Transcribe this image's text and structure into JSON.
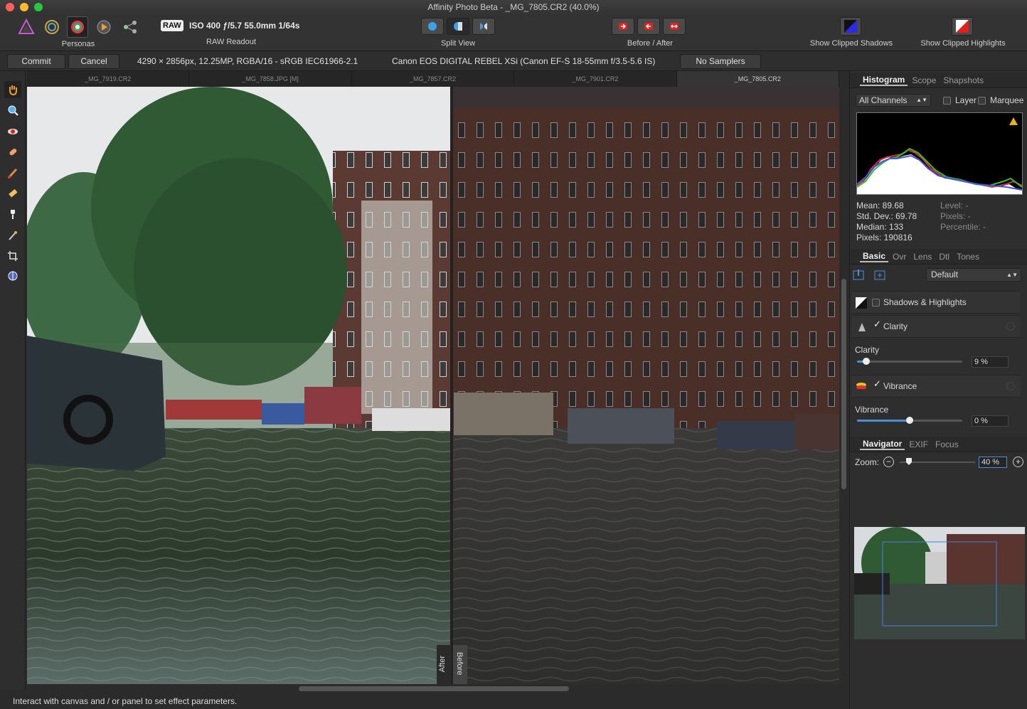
{
  "window": {
    "title": "Affinity Photo Beta - _MG_7805.CR2 (40.0%)"
  },
  "toolbar": {
    "personas_label": "Personas",
    "raw_badge": "RAW",
    "raw_readout_text": "ISO 400 ƒ/5.7 55.0mm 1/64s",
    "raw_readout_label": "RAW Readout",
    "split_view_label": "Split View",
    "before_after_label": "Before / After",
    "show_clipped_shadows": "Show Clipped Shadows",
    "show_clipped_highlights": "Show Clipped Highlights"
  },
  "context": {
    "commit": "Commit",
    "cancel": "Cancel",
    "image_info": "4290 × 2856px, 12.25MP, RGBA/16 - sRGB IEC61966-2.1",
    "camera_info": "Canon EOS DIGITAL REBEL XSi (Canon EF-S 18-55mm f/3.5-5.6 IS)",
    "samplers": "No Samplers"
  },
  "doc_tabs": [
    "_MG_7919.CR2",
    "_MG_7858.JPG [M]",
    "_MG_7857.CR2",
    "_MG_7901.CR2",
    "_MG_7805.CR2"
  ],
  "canvas": {
    "after_label": "After",
    "before_label": "Before"
  },
  "status": "Interact with canvas and / or panel to set effect parameters.",
  "histogram_panel": {
    "tabs": [
      "Histogram",
      "Scope",
      "Shapshots"
    ],
    "channel": "All Channels",
    "layer_label": "Layer",
    "marquee_label": "Marquee",
    "mean": "Mean: 89.68",
    "stddev": "Std. Dev.: 69.78",
    "median": "Median: 133",
    "pixels": "Pixels: 190816",
    "level": "Level: -",
    "pixels_r": "Pixels: -",
    "percentile": "Percentile: -"
  },
  "develop_panel": {
    "tabs": [
      "Basic",
      "Ovr",
      "Lens",
      "Dtl",
      "Tones"
    ],
    "preset": "Default",
    "shadows_highlights": "Shadows & Highlights",
    "clarity_title": "Clarity",
    "clarity_label": "Clarity",
    "clarity_value": "9 %",
    "clarity_fraction": 0.09,
    "vibrance_title": "Vibrance",
    "vibrance_label": "Vibrance",
    "vibrance_value": "0 %",
    "vibrance_fraction": 0.5
  },
  "navigator_panel": {
    "tabs": [
      "Navigator",
      "EXIF",
      "Focus"
    ],
    "zoom_label": "Zoom:",
    "zoom_value": "40 %"
  }
}
